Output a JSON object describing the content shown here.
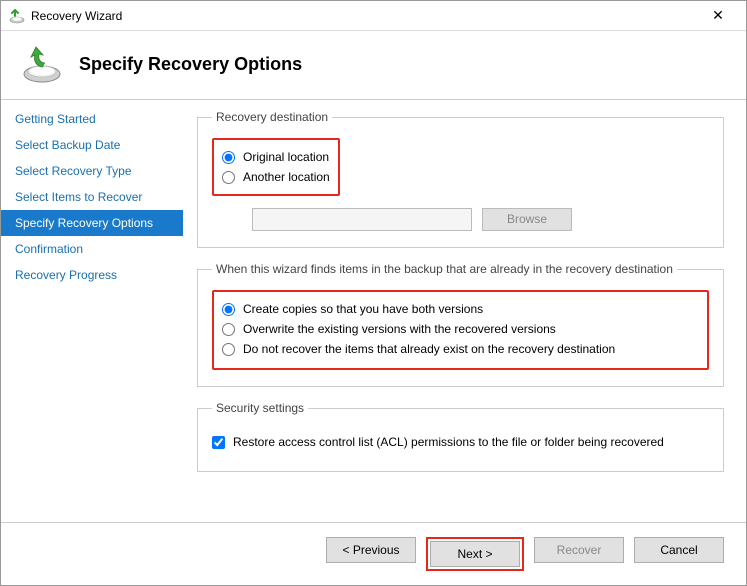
{
  "window": {
    "title": "Recovery Wizard"
  },
  "header": {
    "title": "Specify Recovery Options"
  },
  "sidebar": {
    "items": [
      {
        "label": "Getting Started"
      },
      {
        "label": "Select Backup Date"
      },
      {
        "label": "Select Recovery Type"
      },
      {
        "label": "Select Items to Recover"
      },
      {
        "label": "Specify Recovery Options"
      },
      {
        "label": "Confirmation"
      },
      {
        "label": "Recovery Progress"
      }
    ],
    "activeIndex": 4
  },
  "destination": {
    "legend": "Recovery destination",
    "original": "Original location",
    "another": "Another location",
    "path": "",
    "browse": "Browse"
  },
  "collision": {
    "legend": "When this wizard finds items in the backup that are already in the recovery destination",
    "opt_copies": "Create copies so that you have both versions",
    "opt_overwrite": "Overwrite the existing versions with the recovered versions",
    "opt_skip": "Do not recover the items that already exist on the recovery destination"
  },
  "security": {
    "legend": "Security settings",
    "restore_acl": "Restore access control list (ACL) permissions to the file or folder being recovered"
  },
  "footer": {
    "previous": "< Previous",
    "next": "Next >",
    "recover": "Recover",
    "cancel": "Cancel"
  }
}
